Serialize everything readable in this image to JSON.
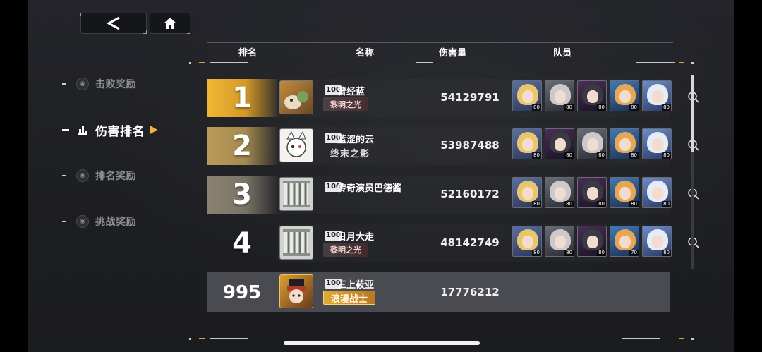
{
  "nav": {
    "back_glyph": "<",
    "items": [
      {
        "label": "击败奖励",
        "icon": "medal-icon",
        "active": false
      },
      {
        "label": "伤害排名",
        "icon": "bar-chart-icon",
        "active": true
      },
      {
        "label": "排名奖励",
        "icon": "medal-icon",
        "active": false
      },
      {
        "label": "挑战奖励",
        "icon": "medal-icon",
        "active": false
      }
    ]
  },
  "header": {
    "rank": "排名",
    "name": "名称",
    "damage": "伤害量",
    "team": "队员"
  },
  "rows": [
    {
      "rank": "1",
      "level": "100",
      "name": "曾经蓝",
      "guild": "黎明之光",
      "damage": "54129791",
      "team_levels": [
        "80",
        "80",
        "80",
        "80",
        "80"
      ]
    },
    {
      "rank": "2",
      "level": "100",
      "name": "蓝涩的云",
      "guild": "终末之影",
      "damage": "53987488",
      "team_levels": [
        "80",
        "80",
        "80",
        "80",
        "80"
      ]
    },
    {
      "rank": "3",
      "level": "100",
      "name": "传奇演员巴德酱",
      "guild": "",
      "damage": "52160172",
      "team_levels": [
        "80",
        "80",
        "80",
        "80",
        "80"
      ]
    },
    {
      "rank": "4",
      "level": "100",
      "name": "日月大走",
      "guild": "黎明之光",
      "damage": "48142749",
      "team_levels": [
        "80",
        "80",
        "80",
        "70",
        "80"
      ]
    }
  ],
  "self": {
    "rank": "995",
    "level": "100",
    "name": "三上莜亚",
    "guild": "浪漫战士",
    "damage": "17776212"
  },
  "colors": {
    "accent": "#f2b233",
    "background": "#1e1f23",
    "self_row": "#4a4b50"
  }
}
